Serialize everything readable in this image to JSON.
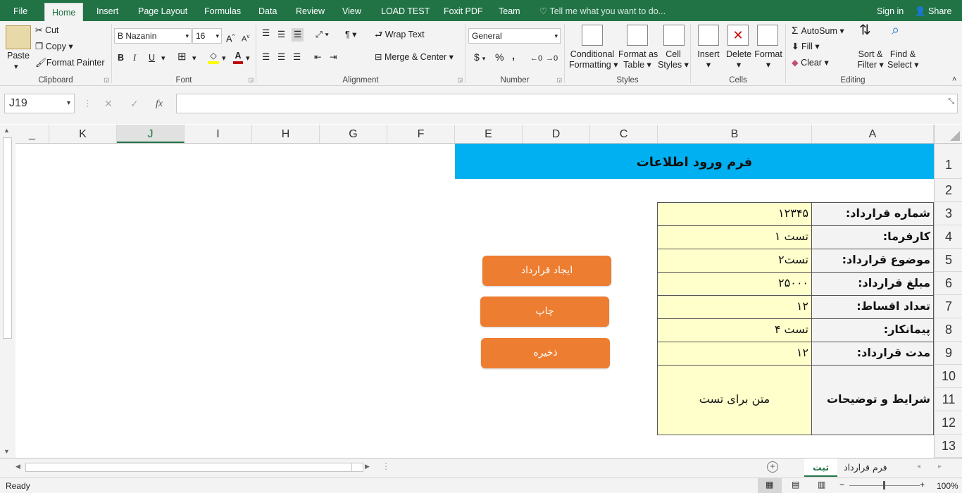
{
  "menu": {
    "file": "File",
    "home": "Home",
    "insert": "Insert",
    "page_layout": "Page Layout",
    "formulas": "Formulas",
    "data": "Data",
    "review": "Review",
    "view": "View",
    "load_test": "LOAD TEST",
    "foxit": "Foxit PDF",
    "team": "Team",
    "tell_me": "Tell me what you want to do...",
    "sign_in": "Sign in",
    "share": "Share"
  },
  "ribbon": {
    "clipboard": {
      "label": "Clipboard",
      "paste": "Paste",
      "cut": "Cut",
      "copy": "Copy",
      "format_painter": "Format Painter"
    },
    "font": {
      "label": "Font",
      "family": "B Nazanin",
      "size": "16",
      "bold": "B",
      "italic": "I",
      "underline": "U",
      "font_color_glyph": "A"
    },
    "alignment": {
      "label": "Alignment",
      "wrap_text": "Wrap Text",
      "merge_center": "Merge & Center"
    },
    "number": {
      "label": "Number",
      "format": "General",
      "currency": "$",
      "percent": "%",
      "comma": ","
    },
    "styles": {
      "label": "Styles",
      "conditional_formatting_1": "Conditional",
      "conditional_formatting_2": "Formatting",
      "format_as_table_1": "Format as",
      "format_as_table_2": "Table",
      "cell_styles_1": "Cell",
      "cell_styles_2": "Styles"
    },
    "cells": {
      "label": "Cells",
      "insert": "Insert",
      "delete": "Delete",
      "format": "Format"
    },
    "editing": {
      "label": "Editing",
      "autosum": "AutoSum",
      "fill": "Fill",
      "clear": "Clear",
      "sort_filter_1": "Sort &",
      "sort_filter_2": "Filter",
      "find_select_1": "Find &",
      "find_select_2": "Select"
    }
  },
  "formula_bar": {
    "name_box": "J19",
    "formula": "",
    "fx": "fx"
  },
  "columns": [
    "A",
    "B",
    "C",
    "D",
    "E",
    "F",
    "G",
    "H",
    "I",
    "J",
    "K",
    "_"
  ],
  "rows": [
    "1",
    "2",
    "3",
    "4",
    "5",
    "6",
    "7",
    "8",
    "9",
    "10",
    "11",
    "12",
    "13"
  ],
  "sheet": {
    "title": "فرم ورود اطلاعات",
    "fields": [
      {
        "label": "شماره قرارداد:",
        "value": "۱۲۳۴۵"
      },
      {
        "label": "کارفرما:",
        "value": "تست ۱"
      },
      {
        "label": "موضوع قرارداد:",
        "value": "تست۲"
      },
      {
        "label": "مبلغ قرارداد:",
        "value": "۲۵۰۰۰"
      },
      {
        "label": "تعداد اقساط:",
        "value": "۱۲"
      },
      {
        "label": "پیمانکار:",
        "value": "تست ۴"
      },
      {
        "label": "مدت قرارداد:",
        "value": "۱۲"
      }
    ],
    "terms_label": "شرایط و توضیحات",
    "terms_value": "متن برای تست",
    "buttons": {
      "create": "ایجاد قرارداد",
      "print": "چاپ",
      "save": "ذخیره"
    }
  },
  "sheet_tabs": {
    "active": "ثبت",
    "other": "فرم قرارداد"
  },
  "status": {
    "ready": "Ready",
    "zoom": "100%"
  },
  "colors": {
    "accent": "#217346",
    "title_band": "#00b0f0",
    "input_fill": "#ffffcc",
    "button": "#ed7d31"
  }
}
